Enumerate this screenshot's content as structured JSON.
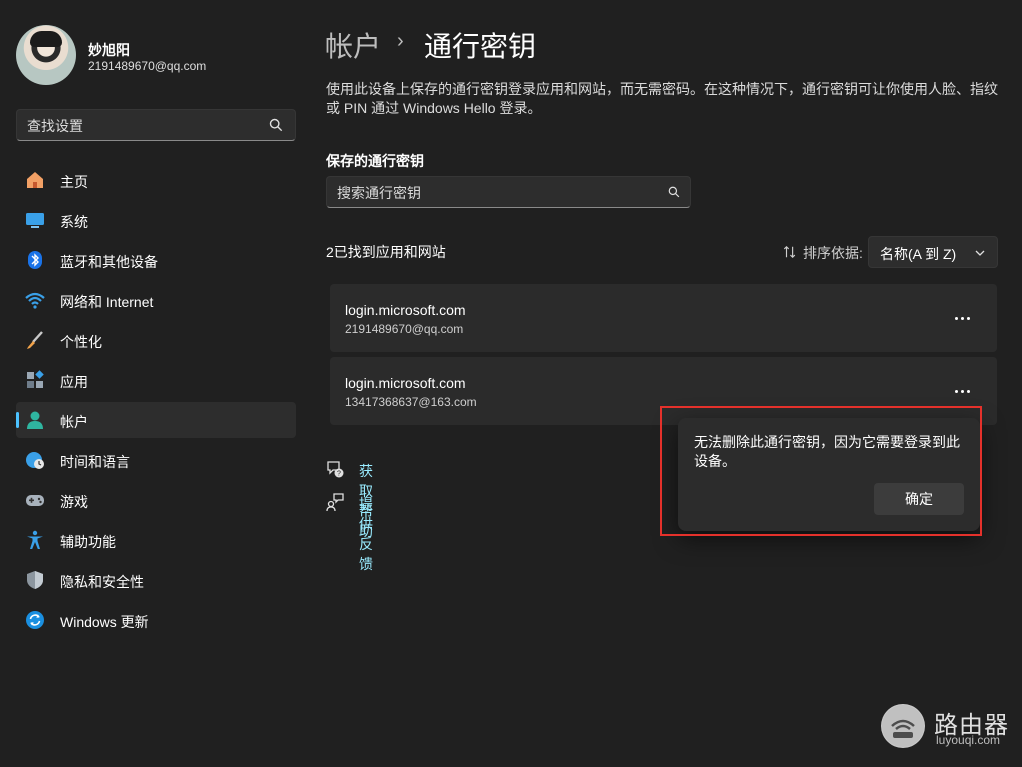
{
  "user": {
    "name": "妙旭阳",
    "email": "2191489670@qq.com"
  },
  "sidebar": {
    "search_placeholder": "查找设置",
    "items": [
      {
        "label": "主页",
        "icon": "home-icon"
      },
      {
        "label": "系统",
        "icon": "system-icon"
      },
      {
        "label": "蓝牙和其他设备",
        "icon": "bluetooth-icon"
      },
      {
        "label": "网络和 Internet",
        "icon": "wifi-icon"
      },
      {
        "label": "个性化",
        "icon": "brush-icon"
      },
      {
        "label": "应用",
        "icon": "apps-icon"
      },
      {
        "label": "帐户",
        "icon": "account-icon",
        "active": true
      },
      {
        "label": "时间和语言",
        "icon": "globe-clock-icon"
      },
      {
        "label": "游戏",
        "icon": "gamepad-icon"
      },
      {
        "label": "辅助功能",
        "icon": "accessibility-icon"
      },
      {
        "label": "隐私和安全性",
        "icon": "shield-icon"
      },
      {
        "label": "Windows 更新",
        "icon": "update-icon"
      }
    ]
  },
  "header": {
    "parent": "帐户",
    "separator": "›",
    "current": "通行密钥"
  },
  "description": "使用此设备上保存的通行密钥登录应用和网站，而无需密码。在这种情况下，通行密钥可让你使用人脸、指纹或 PIN 通过 Windows Hello 登录。",
  "saved": {
    "title": "保存的通行密钥",
    "search_placeholder": "搜索通行密钥",
    "found_text": "2已找到应用和网站",
    "sort_label": "排序依据:",
    "sort_value": "名称(A 到 Z)",
    "passkeys": [
      {
        "site": "login.microsoft.com",
        "account": "2191489670@qq.com"
      },
      {
        "site": "login.microsoft.com",
        "account": "13417368637@163.com"
      }
    ]
  },
  "links": {
    "help": "获取帮助",
    "feedback": "提供反馈"
  },
  "popup": {
    "message": "无法删除此通行密钥，因为它需要登录到此设备。",
    "ok": "确定"
  },
  "watermark": {
    "name": "路由器",
    "url": "luyouqi.com"
  },
  "colors": {
    "accent": "#4cc2ff",
    "link": "#99ebff",
    "highlight": "#e5312b"
  }
}
